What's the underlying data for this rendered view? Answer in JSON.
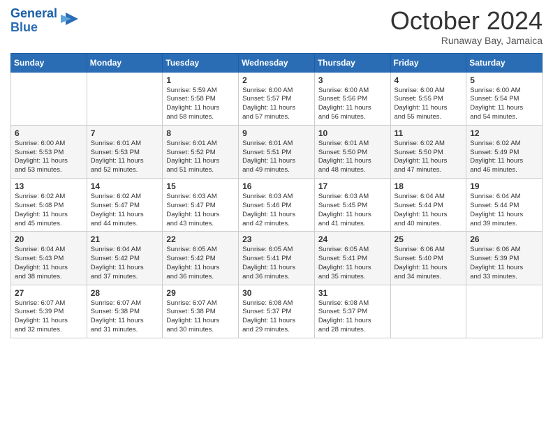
{
  "logo": {
    "line1": "General",
    "line2": "Blue"
  },
  "title": "October 2024",
  "location": "Runaway Bay, Jamaica",
  "days_header": [
    "Sunday",
    "Monday",
    "Tuesday",
    "Wednesday",
    "Thursday",
    "Friday",
    "Saturday"
  ],
  "weeks": [
    [
      {
        "day": "",
        "info": ""
      },
      {
        "day": "",
        "info": ""
      },
      {
        "day": "1",
        "info": "Sunrise: 5:59 AM\nSunset: 5:58 PM\nDaylight: 11 hours\nand 58 minutes."
      },
      {
        "day": "2",
        "info": "Sunrise: 6:00 AM\nSunset: 5:57 PM\nDaylight: 11 hours\nand 57 minutes."
      },
      {
        "day": "3",
        "info": "Sunrise: 6:00 AM\nSunset: 5:56 PM\nDaylight: 11 hours\nand 56 minutes."
      },
      {
        "day": "4",
        "info": "Sunrise: 6:00 AM\nSunset: 5:55 PM\nDaylight: 11 hours\nand 55 minutes."
      },
      {
        "day": "5",
        "info": "Sunrise: 6:00 AM\nSunset: 5:54 PM\nDaylight: 11 hours\nand 54 minutes."
      }
    ],
    [
      {
        "day": "6",
        "info": "Sunrise: 6:00 AM\nSunset: 5:53 PM\nDaylight: 11 hours\nand 53 minutes."
      },
      {
        "day": "7",
        "info": "Sunrise: 6:01 AM\nSunset: 5:53 PM\nDaylight: 11 hours\nand 52 minutes."
      },
      {
        "day": "8",
        "info": "Sunrise: 6:01 AM\nSunset: 5:52 PM\nDaylight: 11 hours\nand 51 minutes."
      },
      {
        "day": "9",
        "info": "Sunrise: 6:01 AM\nSunset: 5:51 PM\nDaylight: 11 hours\nand 49 minutes."
      },
      {
        "day": "10",
        "info": "Sunrise: 6:01 AM\nSunset: 5:50 PM\nDaylight: 11 hours\nand 48 minutes."
      },
      {
        "day": "11",
        "info": "Sunrise: 6:02 AM\nSunset: 5:50 PM\nDaylight: 11 hours\nand 47 minutes."
      },
      {
        "day": "12",
        "info": "Sunrise: 6:02 AM\nSunset: 5:49 PM\nDaylight: 11 hours\nand 46 minutes."
      }
    ],
    [
      {
        "day": "13",
        "info": "Sunrise: 6:02 AM\nSunset: 5:48 PM\nDaylight: 11 hours\nand 45 minutes."
      },
      {
        "day": "14",
        "info": "Sunrise: 6:02 AM\nSunset: 5:47 PM\nDaylight: 11 hours\nand 44 minutes."
      },
      {
        "day": "15",
        "info": "Sunrise: 6:03 AM\nSunset: 5:47 PM\nDaylight: 11 hours\nand 43 minutes."
      },
      {
        "day": "16",
        "info": "Sunrise: 6:03 AM\nSunset: 5:46 PM\nDaylight: 11 hours\nand 42 minutes."
      },
      {
        "day": "17",
        "info": "Sunrise: 6:03 AM\nSunset: 5:45 PM\nDaylight: 11 hours\nand 41 minutes."
      },
      {
        "day": "18",
        "info": "Sunrise: 6:04 AM\nSunset: 5:44 PM\nDaylight: 11 hours\nand 40 minutes."
      },
      {
        "day": "19",
        "info": "Sunrise: 6:04 AM\nSunset: 5:44 PM\nDaylight: 11 hours\nand 39 minutes."
      }
    ],
    [
      {
        "day": "20",
        "info": "Sunrise: 6:04 AM\nSunset: 5:43 PM\nDaylight: 11 hours\nand 38 minutes."
      },
      {
        "day": "21",
        "info": "Sunrise: 6:04 AM\nSunset: 5:42 PM\nDaylight: 11 hours\nand 37 minutes."
      },
      {
        "day": "22",
        "info": "Sunrise: 6:05 AM\nSunset: 5:42 PM\nDaylight: 11 hours\nand 36 minutes."
      },
      {
        "day": "23",
        "info": "Sunrise: 6:05 AM\nSunset: 5:41 PM\nDaylight: 11 hours\nand 36 minutes."
      },
      {
        "day": "24",
        "info": "Sunrise: 6:05 AM\nSunset: 5:41 PM\nDaylight: 11 hours\nand 35 minutes."
      },
      {
        "day": "25",
        "info": "Sunrise: 6:06 AM\nSunset: 5:40 PM\nDaylight: 11 hours\nand 34 minutes."
      },
      {
        "day": "26",
        "info": "Sunrise: 6:06 AM\nSunset: 5:39 PM\nDaylight: 11 hours\nand 33 minutes."
      }
    ],
    [
      {
        "day": "27",
        "info": "Sunrise: 6:07 AM\nSunset: 5:39 PM\nDaylight: 11 hours\nand 32 minutes."
      },
      {
        "day": "28",
        "info": "Sunrise: 6:07 AM\nSunset: 5:38 PM\nDaylight: 11 hours\nand 31 minutes."
      },
      {
        "day": "29",
        "info": "Sunrise: 6:07 AM\nSunset: 5:38 PM\nDaylight: 11 hours\nand 30 minutes."
      },
      {
        "day": "30",
        "info": "Sunrise: 6:08 AM\nSunset: 5:37 PM\nDaylight: 11 hours\nand 29 minutes."
      },
      {
        "day": "31",
        "info": "Sunrise: 6:08 AM\nSunset: 5:37 PM\nDaylight: 11 hours\nand 28 minutes."
      },
      {
        "day": "",
        "info": ""
      },
      {
        "day": "",
        "info": ""
      }
    ]
  ]
}
